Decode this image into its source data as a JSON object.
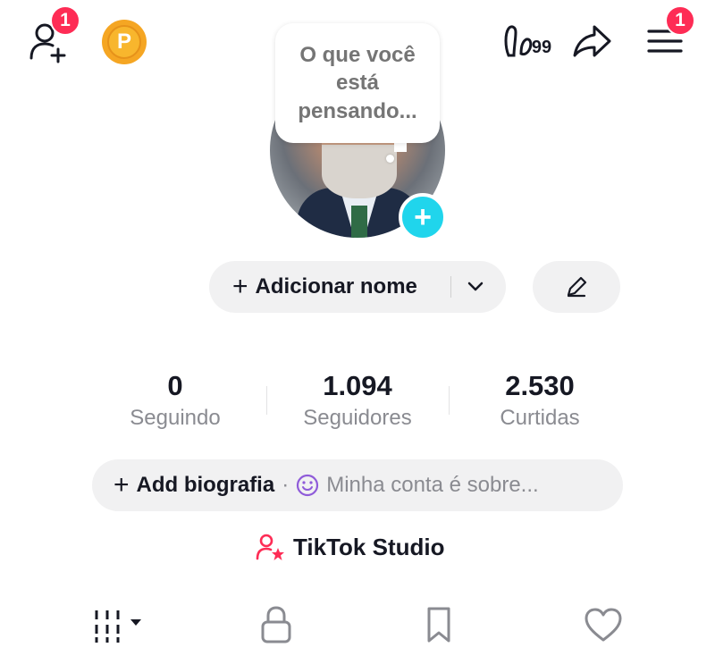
{
  "header": {
    "add_friend_badge": "1",
    "coin_letter": "P",
    "footprints_label": "99",
    "menu_badge": "1"
  },
  "profile": {
    "thought_bubble": "O que você está pensando...",
    "add_name_label": "Adicionar nome"
  },
  "stats": [
    {
      "value": "0",
      "label": "Seguindo"
    },
    {
      "value": "1.094",
      "label": "Seguidores"
    },
    {
      "value": "2.530",
      "label": "Curtidas"
    }
  ],
  "bio": {
    "add_label": "Add biografia",
    "separator": "·",
    "placeholder": "Minha conta é sobre..."
  },
  "studio": {
    "label": "TikTok Studio"
  },
  "colors": {
    "accent": "#fe2c55",
    "cyan": "#20d5ec",
    "coin": "#f5a623",
    "emoji_purple": "#8f5bd9"
  },
  "tabs": [
    {
      "icon": "videos-grid-icon"
    },
    {
      "icon": "lock-icon"
    },
    {
      "icon": "bookmark-icon"
    },
    {
      "icon": "heart-icon"
    }
  ]
}
